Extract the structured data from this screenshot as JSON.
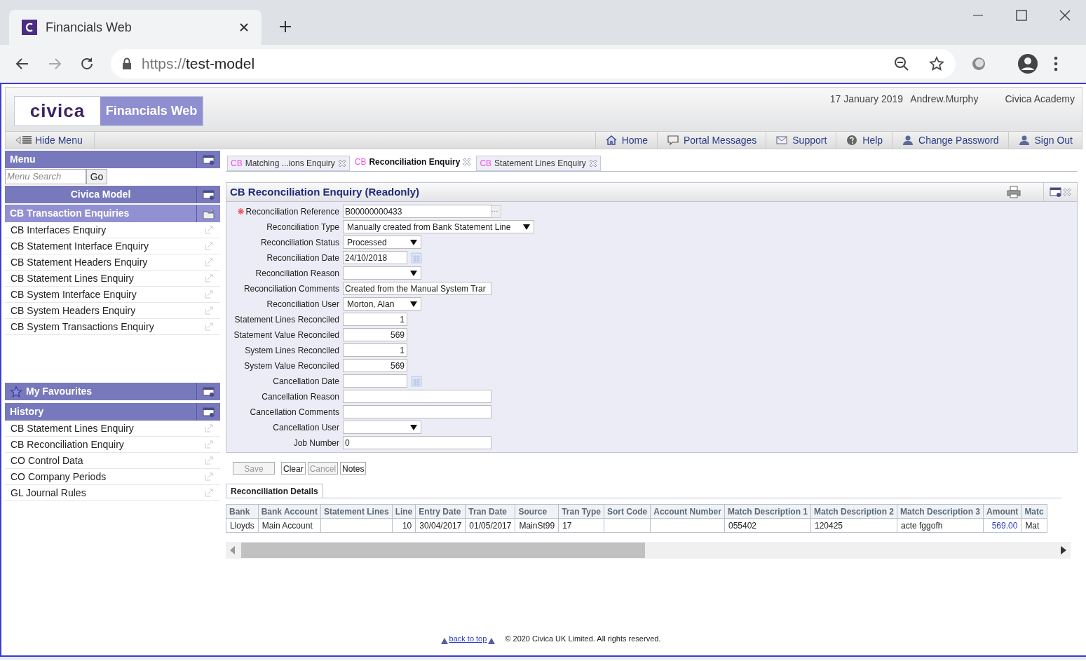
{
  "browser": {
    "tab_title": "Financials Web",
    "url_scheme": "https://",
    "url_host": "test-model"
  },
  "header": {
    "logo": "civica",
    "product": "Financials Web",
    "date": "17 January 2019",
    "user": "Andrew.Murphy",
    "organisation": "Civica Academy"
  },
  "toolbar": {
    "hide_menu": "Hide Menu",
    "links": [
      {
        "kind": "home",
        "label": "Home"
      },
      {
        "kind": "messages",
        "label": "Portal Messages"
      },
      {
        "kind": "support",
        "label": "Support"
      },
      {
        "kind": "help",
        "label": "Help"
      },
      {
        "kind": "password",
        "label": "Change Password"
      },
      {
        "kind": "signout",
        "label": "Sign Out"
      }
    ]
  },
  "sidebar": {
    "menu_title": "Menu",
    "search": {
      "placeholder": "Menu Search",
      "button": "Go"
    },
    "section": "Civica Model",
    "group": {
      "title": "CB Transaction Enquiries",
      "items": [
        "CB Interfaces Enquiry",
        "CB Statement Interface Enquiry",
        "CB Statement Headers Enquiry",
        "CB Statement Lines Enquiry",
        "CB System Interface Enquiry",
        "CB System Headers Enquiry",
        "CB System Transactions Enquiry"
      ]
    },
    "favourites": {
      "title": "My Favourites"
    },
    "history": {
      "title": "History",
      "items": [
        "CB Statement Lines Enquiry",
        "CB Reconciliation Enquiry",
        "CO Control Data",
        "CO Company Periods",
        "GL Journal Rules"
      ]
    }
  },
  "tabs": [
    {
      "prefix": "CB",
      "label": "Matching ...ions Enquiry",
      "selected": false
    },
    {
      "prefix": "CB",
      "label": "Reconciliation Enquiry",
      "selected": true
    },
    {
      "prefix": "CB",
      "label": "Statement Lines Enquiry",
      "selected": false
    }
  ],
  "form": {
    "title": "CB Reconciliation Enquiry (Readonly)",
    "fields": [
      {
        "label": "Reconciliation Reference",
        "kind": "lookup",
        "value": "B00000000433",
        "required": true
      },
      {
        "label": "Reconciliation Type",
        "kind": "wideselect",
        "value": "Manually created from Bank Statement Line",
        "required": false
      },
      {
        "label": "Reconciliation Status",
        "kind": "select",
        "value": "Processed",
        "required": false
      },
      {
        "label": "Reconciliation Date",
        "kind": "date",
        "value": "24/10/2018",
        "required": false
      },
      {
        "label": "Reconciliation Reason",
        "kind": "select",
        "required": false
      },
      {
        "label": "Reconciliation Comments",
        "kind": "text",
        "value": "Created from the Manual System Trar",
        "required": false
      },
      {
        "label": "Reconciliation User",
        "kind": "select",
        "value": "Morton, Alan",
        "required": false
      },
      {
        "label": "Statement Lines Reconciled",
        "kind": "number",
        "value": "1",
        "required": false
      },
      {
        "label": "Statement Value Reconciled",
        "kind": "number",
        "value": "569",
        "required": false
      },
      {
        "label": "System Lines Reconciled",
        "kind": "number",
        "value": "1",
        "required": false
      },
      {
        "label": "System Value Reconciled",
        "kind": "number",
        "value": "569",
        "required": false
      },
      {
        "label": "Cancellation Date",
        "kind": "date",
        "required": false
      },
      {
        "label": "Cancellation Reason",
        "kind": "text",
        "required": false
      },
      {
        "label": "Cancellation Comments",
        "kind": "text",
        "required": false
      },
      {
        "label": "Cancellation User",
        "kind": "select",
        "required": false
      },
      {
        "label": "Job Number",
        "kind": "text",
        "value": "0",
        "required": false
      }
    ]
  },
  "buttons": [
    {
      "label": "Save",
      "disabled": true
    },
    {
      "label": "Clear",
      "disabled": false
    },
    {
      "label": "Cancel",
      "disabled": true
    },
    {
      "label": "Notes",
      "disabled": false
    }
  ],
  "details": {
    "tab": "Reconciliation Details",
    "columns": [
      "Bank",
      "Bank Account",
      "Statement Lines",
      "Line",
      "Entry Date",
      "Tran Date",
      "Source",
      "Tran Type",
      "Sort Code",
      "Account Number",
      "Match Description 1",
      "Match Description 2",
      "Match Description 3",
      "Amount",
      "Matc"
    ],
    "rows": [
      [
        "Lloyds",
        "Main Account",
        "",
        "10",
        "30/04/2017",
        "01/05/2017",
        "MainSt99",
        "17",
        "",
        "",
        "055402",
        "120425",
        "acte fggofh",
        "569.00",
        "Mat"
      ]
    ]
  },
  "footer": {
    "back_to_top": "back to top",
    "copyright": "© 2020 Civica UK Limited. All rights reserved."
  }
}
